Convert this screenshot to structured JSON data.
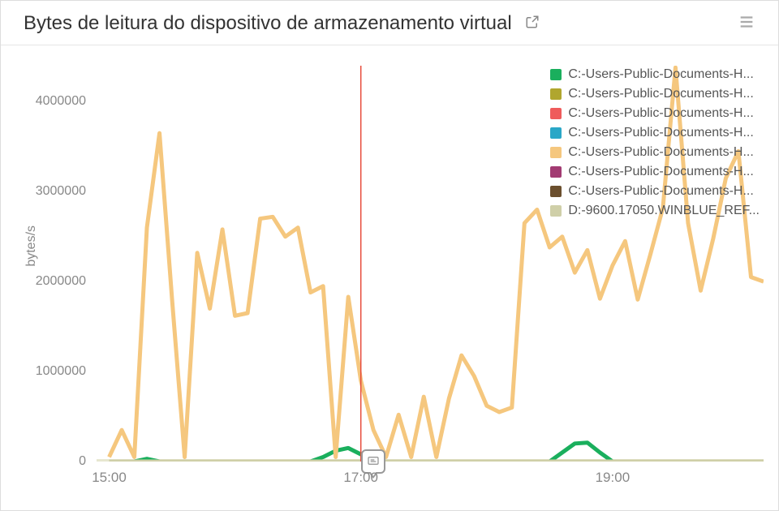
{
  "title": "Bytes de leitura do dispositivo de armazenamento virtual",
  "ylabel": "bytes/s",
  "y_ticks": [
    {
      "value": 0,
      "label": "0"
    },
    {
      "value": 1000000,
      "label": "1000000"
    },
    {
      "value": 2000000,
      "label": "2000000"
    },
    {
      "value": 3000000,
      "label": "3000000"
    },
    {
      "value": 4000000,
      "label": "4000000"
    }
  ],
  "x_ticks": [
    {
      "value": 15.0,
      "label": "15:00"
    },
    {
      "value": 17.0,
      "label": "17:00"
    },
    {
      "value": 19.0,
      "label": "19:00"
    }
  ],
  "legend": [
    {
      "color": "#1aaf5d",
      "label": "C:-Users-Public-Documents-H..."
    },
    {
      "color": "#b0a62e",
      "label": "C:-Users-Public-Documents-H..."
    },
    {
      "color": "#ef5b5b",
      "label": "C:-Users-Public-Documents-H..."
    },
    {
      "color": "#2aa7c7",
      "label": "C:-Users-Public-Documents-H..."
    },
    {
      "color": "#f5c77e",
      "label": "C:-Users-Public-Documents-H..."
    },
    {
      "color": "#a23b72",
      "label": "C:-Users-Public-Documents-H..."
    },
    {
      "color": "#6b4f2e",
      "label": "C:-Users-Public-Documents-H..."
    },
    {
      "color": "#cfcfa8",
      "label": "D:-9600.17050.WINBLUE_REF..."
    }
  ],
  "crosshair_x": 17.0,
  "annotation_x": 17.1,
  "chart_data": {
    "type": "line",
    "xlabel": "",
    "ylabel": "bytes/s",
    "title": "Bytes de leitura do dispositivo de armazenamento virtual",
    "xlim": [
      14.9,
      20.2
    ],
    "ylim": [
      0,
      4400000
    ],
    "x": [
      15.0,
      15.1,
      15.2,
      15.3,
      15.4,
      15.5,
      15.6,
      15.7,
      15.8,
      15.9,
      16.0,
      16.1,
      16.2,
      16.3,
      16.4,
      16.5,
      16.6,
      16.7,
      16.8,
      16.9,
      17.0,
      17.1,
      17.2,
      17.3,
      17.4,
      17.5,
      17.6,
      17.7,
      17.8,
      17.9,
      18.0,
      18.1,
      18.2,
      18.3,
      18.4,
      18.5,
      18.6,
      18.7,
      18.8,
      18.9,
      19.0,
      19.1,
      19.2,
      19.3,
      19.4,
      19.5,
      19.6,
      19.7,
      19.8,
      19.9,
      20.0,
      20.1,
      20.2
    ],
    "series": [
      {
        "name": "C:-Users-Public-Documents-H... (green)",
        "color": "#1aaf5d",
        "values": [
          0,
          0,
          0,
          30000,
          0,
          0,
          0,
          0,
          0,
          0,
          0,
          0,
          0,
          0,
          0,
          0,
          0,
          50000,
          120000,
          150000,
          80000,
          0,
          0,
          0,
          0,
          0,
          0,
          0,
          0,
          0,
          0,
          0,
          0,
          0,
          0,
          0,
          100000,
          200000,
          210000,
          100000,
          0,
          0,
          0,
          0,
          0,
          0,
          0,
          0,
          0,
          0,
          0,
          0,
          0
        ]
      },
      {
        "name": "C:-Users-Public-Documents-H... (orange)",
        "color": "#f5c77e",
        "values": [
          50000,
          350000,
          50000,
          2600000,
          3650000,
          1800000,
          50000,
          2320000,
          1700000,
          2580000,
          1620000,
          1650000,
          2700000,
          2720000,
          2500000,
          2600000,
          1880000,
          1950000,
          50000,
          1830000,
          900000,
          350000,
          50000,
          520000,
          50000,
          720000,
          50000,
          700000,
          1180000,
          950000,
          620000,
          550000,
          600000,
          2650000,
          2800000,
          2380000,
          2500000,
          2100000,
          2350000,
          1810000,
          2180000,
          2450000,
          1800000,
          2300000,
          2820000,
          4380000,
          2650000,
          1900000,
          2480000,
          3150000,
          3450000,
          2050000,
          2000000
        ]
      },
      {
        "name": "D:-9600.17050.WINBLUE_REF...",
        "color": "#cfcfa8",
        "values": [
          0,
          0,
          0,
          0,
          0,
          0,
          0,
          0,
          0,
          0,
          0,
          0,
          0,
          0,
          0,
          0,
          0,
          0,
          0,
          0,
          0,
          0,
          0,
          0,
          0,
          0,
          0,
          0,
          0,
          0,
          0,
          0,
          0,
          0,
          0,
          0,
          0,
          0,
          0,
          0,
          0,
          0,
          0,
          0,
          0,
          0,
          0,
          0,
          0,
          0,
          0,
          0,
          0
        ]
      }
    ]
  }
}
